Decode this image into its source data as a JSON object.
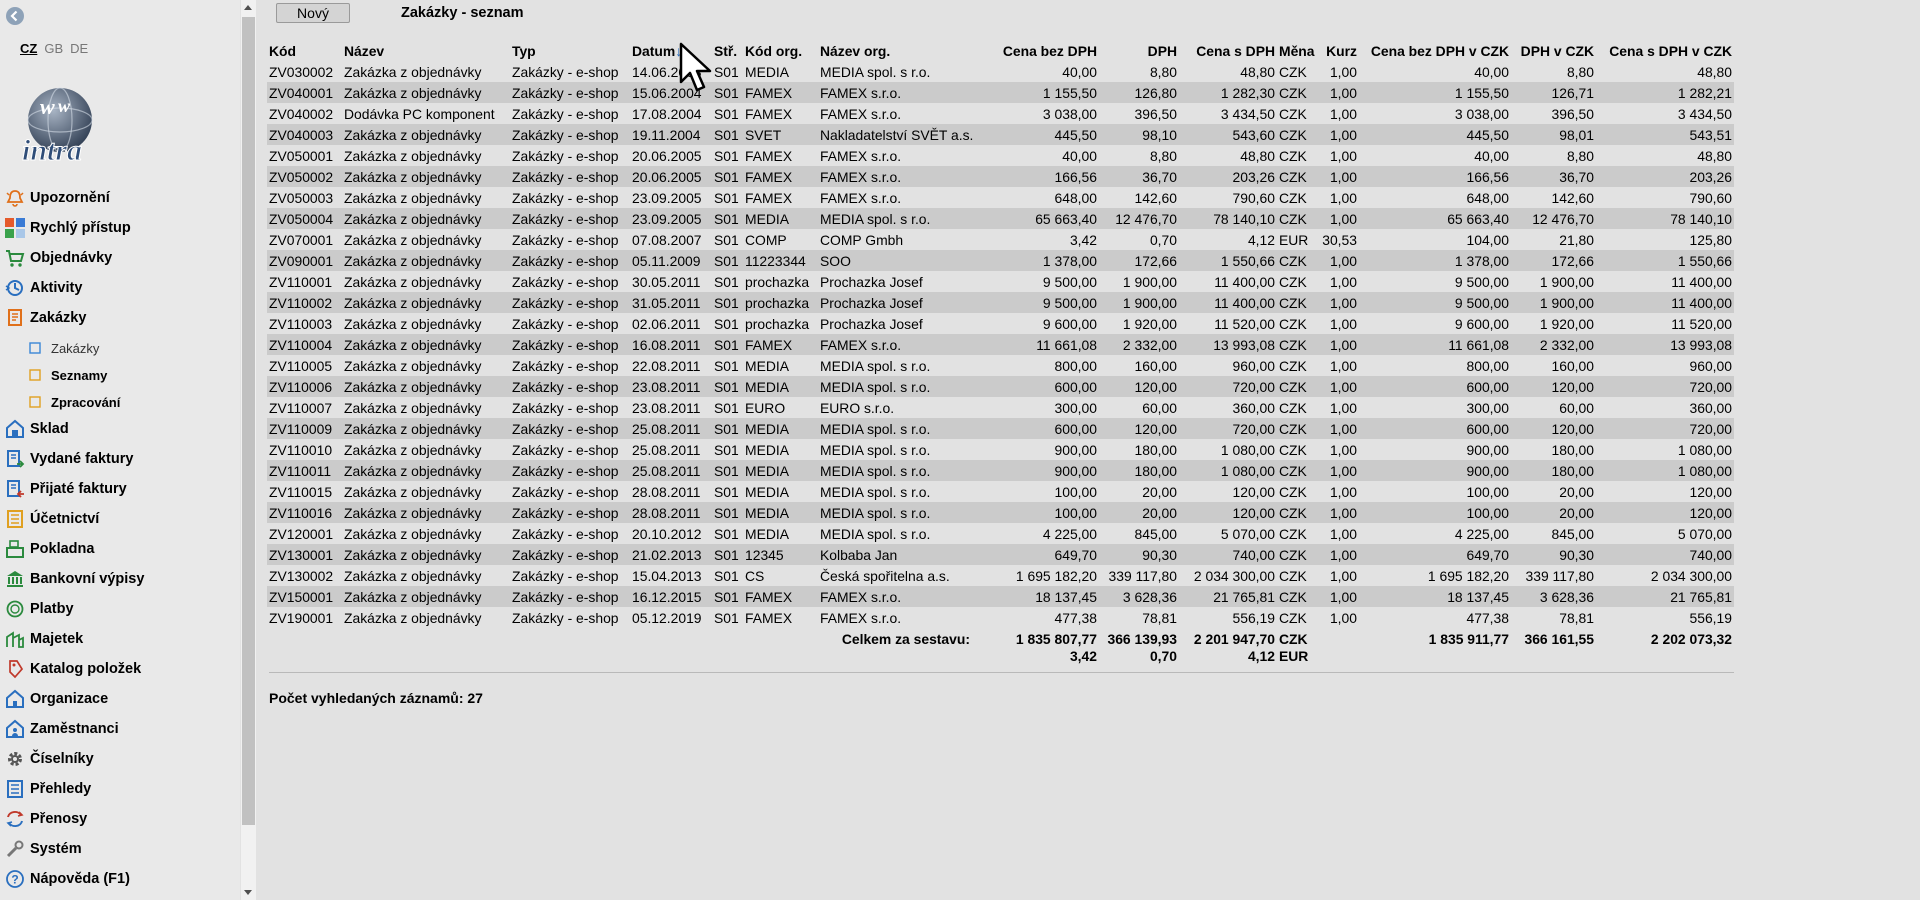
{
  "sidebar": {
    "languages": [
      {
        "code": "CZ",
        "active": true
      },
      {
        "code": "GB",
        "active": false
      },
      {
        "code": "DE",
        "active": false
      }
    ],
    "logo_text": "intra",
    "menu": [
      {
        "label": "Upozornění",
        "icon": "bell-icon"
      },
      {
        "label": "Rychlý přístup",
        "icon": "quick-access-icon"
      },
      {
        "label": "Objednávky",
        "icon": "cart-icon"
      },
      {
        "label": "Aktivity",
        "icon": "activity-icon"
      },
      {
        "label": "Zakázky",
        "icon": "orders-icon"
      },
      {
        "label": "Zakázky",
        "icon": "square-icon",
        "sub": true
      },
      {
        "label": "Seznamy",
        "icon": "square-icon",
        "sub": true,
        "active": true
      },
      {
        "label": "Zpracování",
        "icon": "square-icon",
        "sub": true
      },
      {
        "label": "Sklad",
        "icon": "warehouse-icon"
      },
      {
        "label": "Vydané faktury",
        "icon": "invoice-out-icon"
      },
      {
        "label": "Přijaté faktury",
        "icon": "invoice-in-icon"
      },
      {
        "label": "Účetnictví",
        "icon": "accounting-icon"
      },
      {
        "label": "Pokladna",
        "icon": "cash-register-icon"
      },
      {
        "label": "Bankovní výpisy",
        "icon": "bank-icon"
      },
      {
        "label": "Platby",
        "icon": "payments-icon"
      },
      {
        "label": "Majetek",
        "icon": "property-icon"
      },
      {
        "label": "Katalog položek",
        "icon": "tag-icon"
      },
      {
        "label": "Organizace",
        "icon": "organization-icon"
      },
      {
        "label": "Zaměstnanci",
        "icon": "employees-icon"
      },
      {
        "label": "Číselníky",
        "icon": "gear-icon"
      },
      {
        "label": "Přehledy",
        "icon": "overview-icon"
      },
      {
        "label": "Přenosy",
        "icon": "transfer-icon"
      },
      {
        "label": "Systém",
        "icon": "wrench-icon"
      },
      {
        "label": "Nápověda (F1)",
        "icon": "help-icon"
      }
    ]
  },
  "toolbar": {
    "new_label": "Nový"
  },
  "page": {
    "title": "Zakázky - seznam"
  },
  "table": {
    "columns": [
      "Kód",
      "Název",
      "Typ",
      "Datum",
      "Stř.",
      "Kód org.",
      "Název org.",
      "Cena bez DPH",
      "DPH",
      "Cena s DPH",
      "Měna",
      "Kurz",
      "Cena bez DPH v CZK",
      "DPH v CZK",
      "Cena s DPH v CZK"
    ],
    "sort_indicator": "↓",
    "rows": [
      [
        "ZV030002",
        "Zakázka z objednávky",
        "Zakázky - e-shop",
        "14.06.2003",
        "S01",
        "MEDIA",
        "MEDIA spol. s r.o.",
        "40,00",
        "8,80",
        "48,80",
        "CZK",
        "1,00",
        "40,00",
        "8,80",
        "48,80"
      ],
      [
        "ZV040001",
        "Zakázka z objednávky",
        "Zakázky - e-shop",
        "15.06.2004",
        "S01",
        "FAMEX",
        "FAMEX s.r.o.",
        "1 155,50",
        "126,80",
        "1 282,30",
        "CZK",
        "1,00",
        "1 155,50",
        "126,71",
        "1 282,21"
      ],
      [
        "ZV040002",
        "Dodávka PC komponent",
        "Zakázky - e-shop",
        "17.08.2004",
        "S01",
        "FAMEX",
        "FAMEX s.r.o.",
        "3 038,00",
        "396,50",
        "3 434,50",
        "CZK",
        "1,00",
        "3 038,00",
        "396,50",
        "3 434,50"
      ],
      [
        "ZV040003",
        "Zakázka z objednávky",
        "Zakázky - e-shop",
        "19.11.2004",
        "S01",
        "SVET",
        "Nakladatelství SVĚT a.s.",
        "445,50",
        "98,10",
        "543,60",
        "CZK",
        "1,00",
        "445,50",
        "98,01",
        "543,51"
      ],
      [
        "ZV050001",
        "Zakázka z objednávky",
        "Zakázky - e-shop",
        "20.06.2005",
        "S01",
        "FAMEX",
        "FAMEX s.r.o.",
        "40,00",
        "8,80",
        "48,80",
        "CZK",
        "1,00",
        "40,00",
        "8,80",
        "48,80"
      ],
      [
        "ZV050002",
        "Zakázka z objednávky",
        "Zakázky - e-shop",
        "20.06.2005",
        "S01",
        "FAMEX",
        "FAMEX s.r.o.",
        "166,56",
        "36,70",
        "203,26",
        "CZK",
        "1,00",
        "166,56",
        "36,70",
        "203,26"
      ],
      [
        "ZV050003",
        "Zakázka z objednávky",
        "Zakázky - e-shop",
        "23.09.2005",
        "S01",
        "FAMEX",
        "FAMEX s.r.o.",
        "648,00",
        "142,60",
        "790,60",
        "CZK",
        "1,00",
        "648,00",
        "142,60",
        "790,60"
      ],
      [
        "ZV050004",
        "Zakázka z objednávky",
        "Zakázky - e-shop",
        "23.09.2005",
        "S01",
        "MEDIA",
        "MEDIA spol. s r.o.",
        "65 663,40",
        "12 476,70",
        "78 140,10",
        "CZK",
        "1,00",
        "65 663,40",
        "12 476,70",
        "78 140,10"
      ],
      [
        "ZV070001",
        "Zakázka z objednávky",
        "Zakázky - e-shop",
        "07.08.2007",
        "S01",
        "COMP",
        "COMP Gmbh",
        "3,42",
        "0,70",
        "4,12",
        "EUR",
        "30,53",
        "104,00",
        "21,80",
        "125,80"
      ],
      [
        "ZV090001",
        "Zakázka z objednávky",
        "Zakázky - e-shop",
        "05.11.2009",
        "S01",
        "11223344",
        "SOO",
        "1 378,00",
        "172,66",
        "1 550,66",
        "CZK",
        "1,00",
        "1 378,00",
        "172,66",
        "1 550,66"
      ],
      [
        "ZV110001",
        "Zakázka z objednávky",
        "Zakázky - e-shop",
        "30.05.2011",
        "S01",
        "prochazka",
        "Prochazka Josef",
        "9 500,00",
        "1 900,00",
        "11 400,00",
        "CZK",
        "1,00",
        "9 500,00",
        "1 900,00",
        "11 400,00"
      ],
      [
        "ZV110002",
        "Zakázka z objednávky",
        "Zakázky - e-shop",
        "31.05.2011",
        "S01",
        "prochazka",
        "Prochazka Josef",
        "9 500,00",
        "1 900,00",
        "11 400,00",
        "CZK",
        "1,00",
        "9 500,00",
        "1 900,00",
        "11 400,00"
      ],
      [
        "ZV110003",
        "Zakázka z objednávky",
        "Zakázky - e-shop",
        "02.06.2011",
        "S01",
        "prochazka",
        "Prochazka Josef",
        "9 600,00",
        "1 920,00",
        "11 520,00",
        "CZK",
        "1,00",
        "9 600,00",
        "1 920,00",
        "11 520,00"
      ],
      [
        "ZV110004",
        "Zakázka z objednávky",
        "Zakázky - e-shop",
        "16.08.2011",
        "S01",
        "FAMEX",
        "FAMEX s.r.o.",
        "11 661,08",
        "2 332,00",
        "13 993,08",
        "CZK",
        "1,00",
        "11 661,08",
        "2 332,00",
        "13 993,08"
      ],
      [
        "ZV110005",
        "Zakázka z objednávky",
        "Zakázky - e-shop",
        "22.08.2011",
        "S01",
        "MEDIA",
        "MEDIA spol. s r.o.",
        "800,00",
        "160,00",
        "960,00",
        "CZK",
        "1,00",
        "800,00",
        "160,00",
        "960,00"
      ],
      [
        "ZV110006",
        "Zakázka z objednávky",
        "Zakázky - e-shop",
        "23.08.2011",
        "S01",
        "MEDIA",
        "MEDIA spol. s r.o.",
        "600,00",
        "120,00",
        "720,00",
        "CZK",
        "1,00",
        "600,00",
        "120,00",
        "720,00"
      ],
      [
        "ZV110007",
        "Zakázka z objednávky",
        "Zakázky - e-shop",
        "23.08.2011",
        "S01",
        "EURO",
        "EURO s.r.o.",
        "300,00",
        "60,00",
        "360,00",
        "CZK",
        "1,00",
        "300,00",
        "60,00",
        "360,00"
      ],
      [
        "ZV110009",
        "Zakázka z objednávky",
        "Zakázky - e-shop",
        "25.08.2011",
        "S01",
        "MEDIA",
        "MEDIA spol. s r.o.",
        "600,00",
        "120,00",
        "720,00",
        "CZK",
        "1,00",
        "600,00",
        "120,00",
        "720,00"
      ],
      [
        "ZV110010",
        "Zakázka z objednávky",
        "Zakázky - e-shop",
        "25.08.2011",
        "S01",
        "MEDIA",
        "MEDIA spol. s r.o.",
        "900,00",
        "180,00",
        "1 080,00",
        "CZK",
        "1,00",
        "900,00",
        "180,00",
        "1 080,00"
      ],
      [
        "ZV110011",
        "Zakázka z objednávky",
        "Zakázky - e-shop",
        "25.08.2011",
        "S01",
        "MEDIA",
        "MEDIA spol. s r.o.",
        "900,00",
        "180,00",
        "1 080,00",
        "CZK",
        "1,00",
        "900,00",
        "180,00",
        "1 080,00"
      ],
      [
        "ZV110015",
        "Zakázka z objednávky",
        "Zakázky - e-shop",
        "28.08.2011",
        "S01",
        "MEDIA",
        "MEDIA spol. s r.o.",
        "100,00",
        "20,00",
        "120,00",
        "CZK",
        "1,00",
        "100,00",
        "20,00",
        "120,00"
      ],
      [
        "ZV110016",
        "Zakázka z objednávky",
        "Zakázky - e-shop",
        "28.08.2011",
        "S01",
        "MEDIA",
        "MEDIA spol. s r.o.",
        "100,00",
        "20,00",
        "120,00",
        "CZK",
        "1,00",
        "100,00",
        "20,00",
        "120,00"
      ],
      [
        "ZV120001",
        "Zakázka z objednávky",
        "Zakázky - e-shop",
        "20.10.2012",
        "S01",
        "MEDIA",
        "MEDIA spol. s r.o.",
        "4 225,00",
        "845,00",
        "5 070,00",
        "CZK",
        "1,00",
        "4 225,00",
        "845,00",
        "5 070,00"
      ],
      [
        "ZV130001",
        "Zakázka z objednávky",
        "Zakázky - e-shop",
        "21.02.2013",
        "S01",
        "12345",
        "Kolbaba Jan",
        "649,70",
        "90,30",
        "740,00",
        "CZK",
        "1,00",
        "649,70",
        "90,30",
        "740,00"
      ],
      [
        "ZV130002",
        "Zakázka z objednávky",
        "Zakázky - e-shop",
        "15.04.2013",
        "S01",
        "CS",
        "Česká spořitelna a.s.",
        "1 695 182,20",
        "339 117,80",
        "2 034 300,00",
        "CZK",
        "1,00",
        "1 695 182,20",
        "339 117,80",
        "2 034 300,00"
      ],
      [
        "ZV150001",
        "Zakázka z objednávky",
        "Zakázky - e-shop",
        "16.12.2015",
        "S01",
        "FAMEX",
        "FAMEX s.r.o.",
        "18 137,45",
        "3 628,36",
        "21 765,81",
        "CZK",
        "1,00",
        "18 137,45",
        "3 628,36",
        "21 765,81"
      ],
      [
        "ZV190001",
        "Zakázka z objednávky",
        "Zakázky - e-shop",
        "05.12.2019",
        "S01",
        "FAMEX",
        "FAMEX s.r.o.",
        "477,38",
        "78,81",
        "556,19",
        "CZK",
        "1,00",
        "477,38",
        "78,81",
        "556,19"
      ]
    ],
    "totals": {
      "label": "Celkem za sestavu:",
      "bez_dph": [
        "1 835 807,77",
        "3,42"
      ],
      "dph": [
        "366 139,93",
        "0,70"
      ],
      "s_dph": [
        "2 201 947,70",
        "4,12"
      ],
      "mena": [
        "CZK",
        "EUR"
      ],
      "bez_dph_czk": "1 835 911,77",
      "dph_czk": "366 161,55",
      "s_dph_czk": "2 202 073,32"
    }
  },
  "footer": {
    "count_text": "Počet vyhledaných záznamů: 27"
  },
  "colors": {
    "row_alt": "#cbcbcb",
    "background": "#e2e2e2",
    "sidebar": "#e9e9e9"
  }
}
